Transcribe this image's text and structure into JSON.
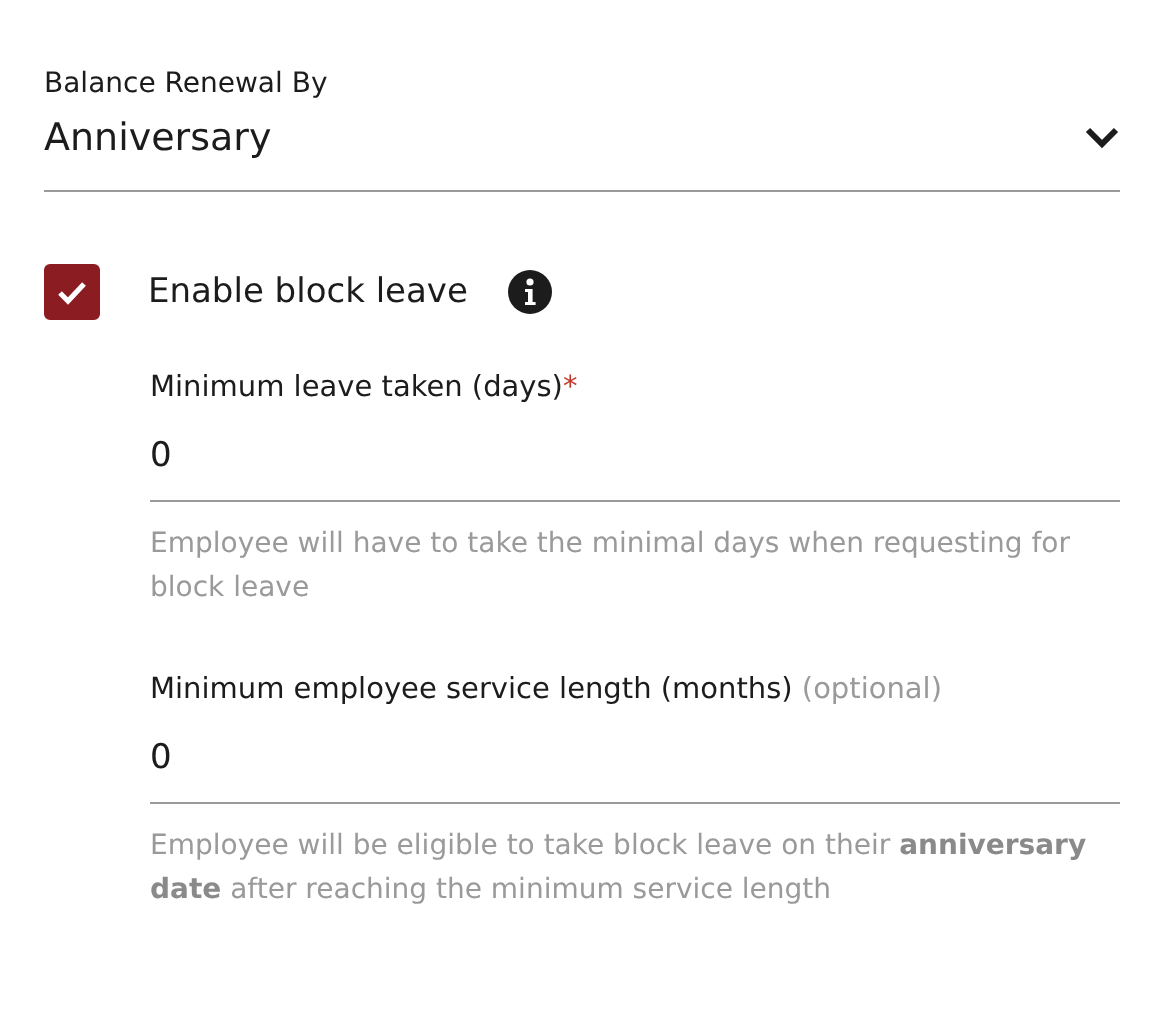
{
  "renewal": {
    "label": "Balance Renewal By",
    "value": "Anniversary",
    "expanded": false
  },
  "block_leave": {
    "label": "Enable block leave",
    "checked": true
  },
  "fields": [
    {
      "label": "Minimum leave taken (days)",
      "required_mark": "*",
      "value": "0",
      "help": "Employee will have to take the minimal days when requesting for block leave"
    },
    {
      "label": "Minimum employee service length (months)",
      "optional_note": "(optional)",
      "value": "0",
      "help": "Employee will be eligible to take block leave on their **anniversary date** after reaching the minimum service length"
    }
  ]
}
